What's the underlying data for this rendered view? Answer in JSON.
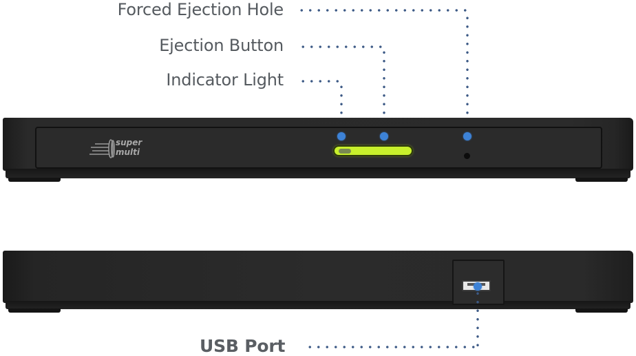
{
  "callouts": {
    "forced_ejection_hole": "Forced Ejection Hole",
    "ejection_button": "Ejection Button",
    "indicator_light": "Indicator Light",
    "usb_port": "USB Port"
  },
  "device": {
    "logo_line1": "super",
    "logo_line2": "multi",
    "front_view": "front",
    "back_view": "back"
  },
  "colors": {
    "leader_dots": "#3d5a86",
    "pin": "#3d82d6",
    "indicator": "#c8f02c",
    "device_body": "#2b2b2b",
    "label_text": "#555a5f"
  }
}
